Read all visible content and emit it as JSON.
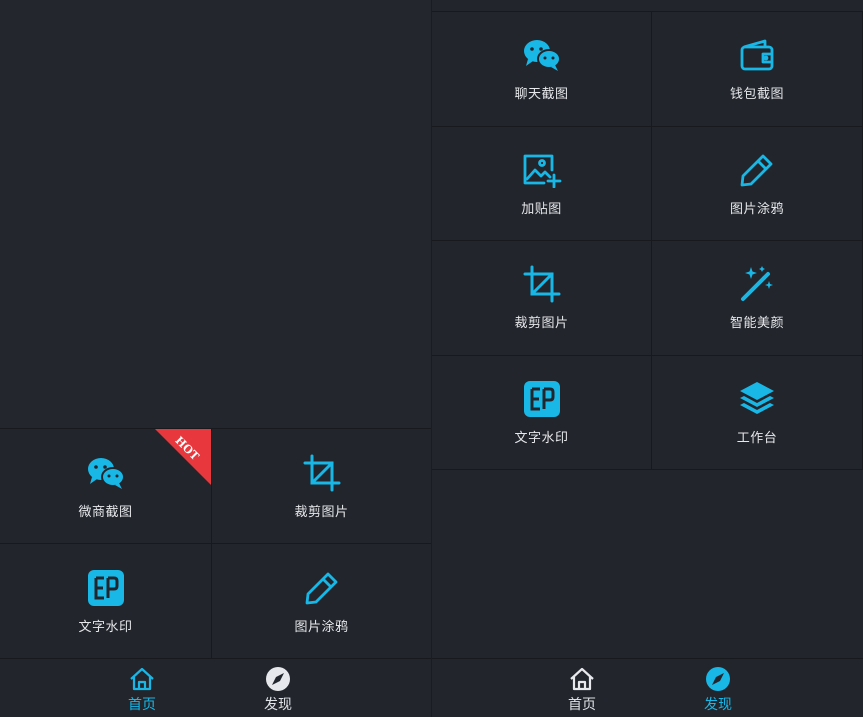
{
  "colors": {
    "accent": "#19b7e6",
    "hot": "#e8383d",
    "background": "#22252c"
  },
  "left": {
    "badge": "HOT",
    "tools": [
      {
        "label": "微商截图",
        "icon": "wechat-icon"
      },
      {
        "label": "裁剪图片",
        "icon": "crop-icon"
      },
      {
        "label": "文字水印",
        "icon": "watermark-icon"
      },
      {
        "label": "图片涂鸦",
        "icon": "pencil-icon"
      }
    ],
    "tabs": [
      {
        "label": "首页",
        "icon": "home-icon",
        "active": true
      },
      {
        "label": "发现",
        "icon": "compass-icon",
        "active": false
      }
    ]
  },
  "right": {
    "tools": [
      {
        "label": "聊天截图",
        "icon": "wechat-icon"
      },
      {
        "label": "钱包截图",
        "icon": "wallet-icon"
      },
      {
        "label": "加贴图",
        "icon": "add-image-icon"
      },
      {
        "label": "图片涂鸦",
        "icon": "pencil-icon"
      },
      {
        "label": "裁剪图片",
        "icon": "crop-icon"
      },
      {
        "label": "智能美颜",
        "icon": "magic-wand-icon"
      },
      {
        "label": "文字水印",
        "icon": "watermark-icon"
      },
      {
        "label": "工作台",
        "icon": "layers-icon"
      }
    ],
    "tabs": [
      {
        "label": "首页",
        "icon": "home-icon",
        "active": false
      },
      {
        "label": "发现",
        "icon": "compass-icon",
        "active": true
      }
    ]
  }
}
